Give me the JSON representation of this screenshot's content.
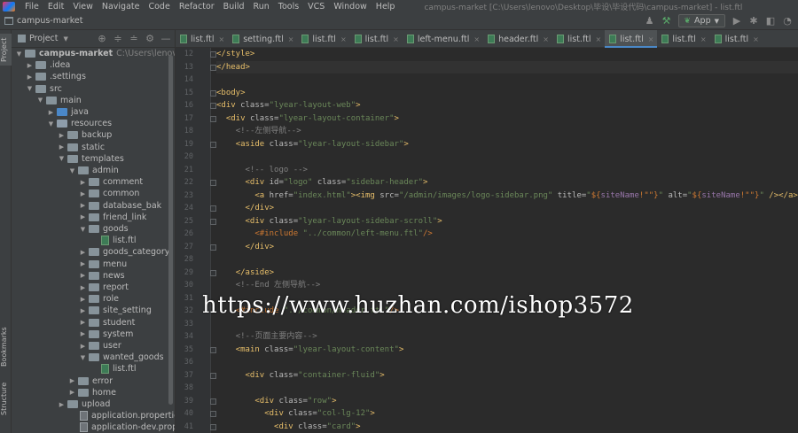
{
  "menubar": {
    "items": [
      "File",
      "Edit",
      "View",
      "Navigate",
      "Code",
      "Refactor",
      "Build",
      "Run",
      "Tools",
      "VCS",
      "Window",
      "Help"
    ],
    "window_title": "campus-market [C:\\Users\\lenovo\\Desktop\\毕设\\毕设代码\\campus-market] - list.ftl"
  },
  "navbar": {
    "project_name": "campus-market",
    "run_config": "App"
  },
  "left_stripe": {
    "project_tab": "Project",
    "bookmarks_tab": "Bookmarks",
    "structure_tab": "Structure"
  },
  "project_panel": {
    "title": "Project",
    "tree": [
      {
        "label": "campus-market",
        "path": "C:\\Users\\lenovo\\Deskt",
        "type": "root",
        "depth": 0,
        "expanded": true
      },
      {
        "label": ".idea",
        "type": "folder",
        "depth": 1,
        "expanded": false
      },
      {
        "label": ".settings",
        "type": "folder",
        "depth": 1,
        "expanded": false
      },
      {
        "label": "src",
        "type": "folder",
        "depth": 1,
        "expanded": true
      },
      {
        "label": "main",
        "type": "folder",
        "depth": 2,
        "expanded": true
      },
      {
        "label": "java",
        "type": "src",
        "depth": 3,
        "expanded": false
      },
      {
        "label": "resources",
        "type": "res",
        "depth": 3,
        "expanded": true
      },
      {
        "label": "backup",
        "type": "folder",
        "depth": 4,
        "expanded": false
      },
      {
        "label": "static",
        "type": "folder",
        "depth": 4,
        "expanded": false
      },
      {
        "label": "templates",
        "type": "folder",
        "depth": 4,
        "expanded": true
      },
      {
        "label": "admin",
        "type": "folder",
        "depth": 5,
        "expanded": true
      },
      {
        "label": "comment",
        "type": "folder",
        "depth": 6,
        "expanded": false
      },
      {
        "label": "common",
        "type": "folder",
        "depth": 6,
        "expanded": false
      },
      {
        "label": "database_bak",
        "type": "folder",
        "depth": 6,
        "expanded": false
      },
      {
        "label": "friend_link",
        "type": "folder",
        "depth": 6,
        "expanded": false
      },
      {
        "label": "goods",
        "type": "folder",
        "depth": 6,
        "expanded": true
      },
      {
        "label": "list.ftl",
        "type": "ftl",
        "depth": 7
      },
      {
        "label": "goods_category",
        "type": "folder",
        "depth": 6,
        "expanded": false
      },
      {
        "label": "menu",
        "type": "folder",
        "depth": 6,
        "expanded": false
      },
      {
        "label": "news",
        "type": "folder",
        "depth": 6,
        "expanded": false
      },
      {
        "label": "report",
        "type": "folder",
        "depth": 6,
        "expanded": false
      },
      {
        "label": "role",
        "type": "folder",
        "depth": 6,
        "expanded": false
      },
      {
        "label": "site_setting",
        "type": "folder",
        "depth": 6,
        "expanded": false
      },
      {
        "label": "student",
        "type": "folder",
        "depth": 6,
        "expanded": false
      },
      {
        "label": "system",
        "type": "folder",
        "depth": 6,
        "expanded": false
      },
      {
        "label": "user",
        "type": "folder",
        "depth": 6,
        "expanded": false
      },
      {
        "label": "wanted_goods",
        "type": "folder",
        "depth": 6,
        "expanded": true
      },
      {
        "label": "list.ftl",
        "type": "ftl",
        "depth": 7
      },
      {
        "label": "error",
        "type": "folder",
        "depth": 5,
        "expanded": false
      },
      {
        "label": "home",
        "type": "folder",
        "depth": 5,
        "expanded": false
      },
      {
        "label": "upload",
        "type": "folder",
        "depth": 4,
        "expanded": false
      },
      {
        "label": "application.properties",
        "type": "prop",
        "depth": 5
      },
      {
        "label": "application-dev.properties",
        "type": "prop",
        "depth": 5
      }
    ]
  },
  "tabs": [
    {
      "label": "list.ftl",
      "active": false
    },
    {
      "label": "setting.ftl",
      "active": false
    },
    {
      "label": "list.ftl",
      "active": false
    },
    {
      "label": "list.ftl",
      "active": false
    },
    {
      "label": "left-menu.ftl",
      "active": false
    },
    {
      "label": "header.ftl",
      "active": false
    },
    {
      "label": "list.ftl",
      "active": false
    },
    {
      "label": "list.ftl",
      "active": true
    },
    {
      "label": "list.ftl",
      "active": false
    },
    {
      "label": "list.ftl",
      "active": false
    }
  ],
  "editor": {
    "lines": [
      {
        "n": "12",
        "segs": [
          [
            "t",
            "</style>"
          ]
        ]
      },
      {
        "n": "13",
        "segs": [
          [
            "t",
            "</head>"
          ]
        ],
        "current": true
      },
      {
        "n": "14",
        "segs": []
      },
      {
        "n": "15",
        "segs": [
          [
            "t",
            "<body>"
          ]
        ]
      },
      {
        "n": "16",
        "segs": [
          [
            "t",
            "<div "
          ],
          [
            "a",
            "class="
          ],
          [
            "s",
            "\"lyear-layout-web\""
          ],
          [
            "t",
            ">"
          ]
        ]
      },
      {
        "n": "17",
        "segs": [
          [
            "p",
            "  "
          ],
          [
            "t",
            "<div "
          ],
          [
            "a",
            "class="
          ],
          [
            "s",
            "\"lyear-layout-container\""
          ],
          [
            "t",
            ">"
          ]
        ]
      },
      {
        "n": "18",
        "segs": [
          [
            "p",
            "    "
          ],
          [
            "c",
            "<!--左侧导航-->"
          ]
        ]
      },
      {
        "n": "19",
        "segs": [
          [
            "p",
            "    "
          ],
          [
            "t",
            "<aside "
          ],
          [
            "a",
            "class="
          ],
          [
            "s",
            "\"lyear-layout-sidebar\""
          ],
          [
            "t",
            ">"
          ]
        ]
      },
      {
        "n": "20",
        "segs": []
      },
      {
        "n": "21",
        "segs": [
          [
            "p",
            "      "
          ],
          [
            "c",
            "<!-- logo -->"
          ]
        ]
      },
      {
        "n": "22",
        "segs": [
          [
            "p",
            "      "
          ],
          [
            "t",
            "<div "
          ],
          [
            "a",
            "id="
          ],
          [
            "s",
            "\"logo\" "
          ],
          [
            "a",
            "class="
          ],
          [
            "s",
            "\"sidebar-header\""
          ],
          [
            "t",
            ">"
          ]
        ]
      },
      {
        "n": "23",
        "segs": [
          [
            "p",
            "        "
          ],
          [
            "t",
            "<a "
          ],
          [
            "a",
            "href="
          ],
          [
            "s",
            "\"index.html\""
          ],
          [
            "t",
            "><img "
          ],
          [
            "a",
            "src="
          ],
          [
            "s",
            "\"/admin/images/logo-sidebar.png\" "
          ],
          [
            "a",
            "title="
          ],
          [
            "s",
            "\""
          ],
          [
            "o",
            "${"
          ],
          [
            "v",
            "siteName"
          ],
          [
            "o",
            "!\"\"}"
          ],
          [
            "s",
            "\" "
          ],
          [
            "a",
            "alt="
          ],
          [
            "s",
            "\""
          ],
          [
            "o",
            "${"
          ],
          [
            "v",
            "siteName"
          ],
          [
            "o",
            "!\"\"}"
          ],
          [
            "s",
            "\" "
          ],
          [
            "t",
            "/></a>"
          ]
        ]
      },
      {
        "n": "24",
        "segs": [
          [
            "p",
            "      "
          ],
          [
            "t",
            "</div>"
          ]
        ]
      },
      {
        "n": "25",
        "segs": [
          [
            "p",
            "      "
          ],
          [
            "t",
            "<div "
          ],
          [
            "a",
            "class="
          ],
          [
            "s",
            "\"lyear-layout-sidebar-scroll\""
          ],
          [
            "t",
            ">"
          ]
        ]
      },
      {
        "n": "26",
        "segs": [
          [
            "p",
            "        "
          ],
          [
            "d",
            "<#include "
          ],
          [
            "s",
            "\"../common/left-menu.ftl\""
          ],
          [
            "d",
            "/>"
          ]
        ]
      },
      {
        "n": "27",
        "segs": [
          [
            "p",
            "      "
          ],
          [
            "t",
            "</div>"
          ]
        ]
      },
      {
        "n": "28",
        "segs": []
      },
      {
        "n": "29",
        "segs": [
          [
            "p",
            "    "
          ],
          [
            "t",
            "</aside>"
          ]
        ]
      },
      {
        "n": "30",
        "segs": [
          [
            "p",
            "    "
          ],
          [
            "c",
            "<!--End 左侧导航-->"
          ]
        ]
      },
      {
        "n": "31",
        "segs": []
      },
      {
        "n": "32",
        "segs": [
          [
            "p",
            "    "
          ],
          [
            "d",
            "<#include "
          ],
          [
            "s",
            "\"../common/header.ftl\""
          ],
          [
            "d",
            "/>"
          ]
        ]
      },
      {
        "n": "33",
        "segs": []
      },
      {
        "n": "34",
        "segs": [
          [
            "p",
            "    "
          ],
          [
            "c",
            "<!--页面主要内容-->"
          ]
        ]
      },
      {
        "n": "35",
        "segs": [
          [
            "p",
            "    "
          ],
          [
            "t",
            "<main "
          ],
          [
            "a",
            "class="
          ],
          [
            "s",
            "\"lyear-layout-content\""
          ],
          [
            "t",
            ">"
          ]
        ]
      },
      {
        "n": "36",
        "segs": []
      },
      {
        "n": "37",
        "segs": [
          [
            "p",
            "      "
          ],
          [
            "t",
            "<div "
          ],
          [
            "a",
            "class="
          ],
          [
            "s",
            "\"container-fluid\""
          ],
          [
            "t",
            ">"
          ]
        ]
      },
      {
        "n": "38",
        "segs": []
      },
      {
        "n": "39",
        "segs": [
          [
            "p",
            "        "
          ],
          [
            "t",
            "<div "
          ],
          [
            "a",
            "class="
          ],
          [
            "s",
            "\"row\""
          ],
          [
            "t",
            ">"
          ]
        ]
      },
      {
        "n": "40",
        "segs": [
          [
            "p",
            "          "
          ],
          [
            "t",
            "<div "
          ],
          [
            "a",
            "class="
          ],
          [
            "s",
            "\"col-lg-12\""
          ],
          [
            "t",
            ">"
          ]
        ]
      },
      {
        "n": "41",
        "segs": [
          [
            "p",
            "            "
          ],
          [
            "t",
            "<div "
          ],
          [
            "a",
            "class="
          ],
          [
            "s",
            "\"card\""
          ],
          [
            "t",
            ">"
          ]
        ]
      }
    ]
  },
  "watermark": "https://www.huzhan.com/ishop3572"
}
